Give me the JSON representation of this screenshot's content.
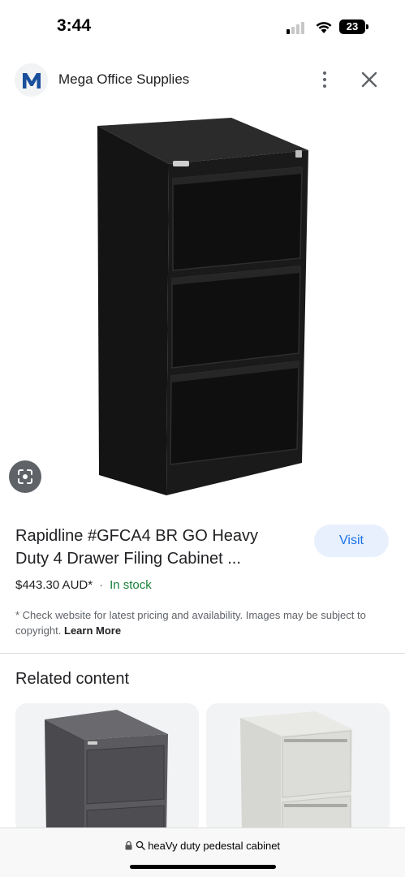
{
  "status_bar": {
    "time": "3:44",
    "battery": "23"
  },
  "header": {
    "site_name": "Mega Office Supplies",
    "logo_letter": "M",
    "logo_color": "#1a4f9c"
  },
  "product": {
    "title": "Rapidline #GFCA4 BR GO Heavy Duty 4 Drawer Filing Cabinet ...",
    "visit_label": "Visit",
    "price": "$443.30 AUD*",
    "separator": "·",
    "stock_status": "In stock",
    "disclaimer": "* Check website for latest pricing and availability. Images may be subject to copyright.",
    "learn_more": "Learn More"
  },
  "related": {
    "heading": "Related content"
  },
  "browser": {
    "url": "heaVy duty pedestal cabinet"
  },
  "colors": {
    "accent": "#1a73e8",
    "visit_bg": "#e8f0fe",
    "stock_green": "#188038"
  }
}
